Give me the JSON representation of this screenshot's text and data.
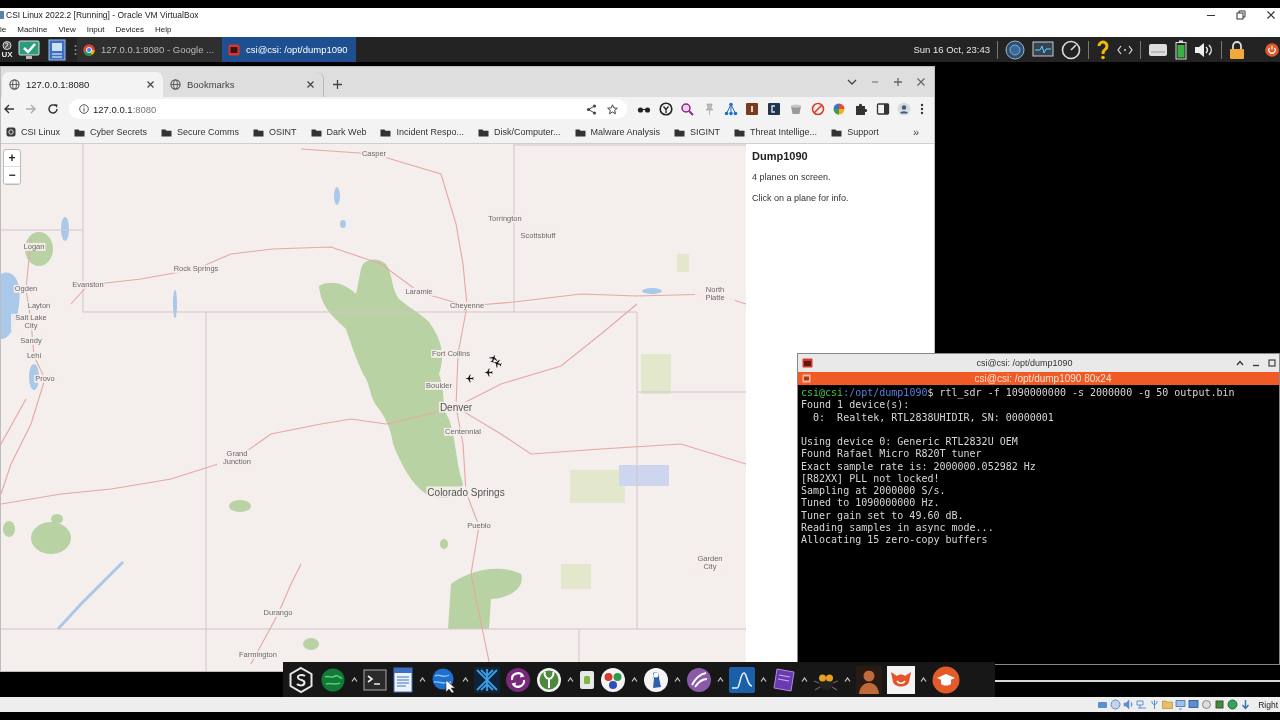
{
  "vbox_window": {
    "title": "CSI Linux 2022.2 [Running] - Oracle VM VirtualBox",
    "menu": [
      "le",
      "Machine",
      "View",
      "Input",
      "Devices",
      "Help"
    ]
  },
  "taskbar": {
    "logo_text": "UX",
    "tasks": [
      {
        "label": "127.0.0.1:8080 - Google ...",
        "kind": "browser",
        "selected": false
      },
      {
        "label": "csi@csi: /opt/dump1090",
        "kind": "terminal",
        "selected": true
      }
    ],
    "clock": "Sun 16 Oct, 23:43"
  },
  "browser": {
    "tabs": [
      {
        "label": "127.0.0.1:8080",
        "selected": true
      },
      {
        "label": "Bookmarks",
        "selected": false
      }
    ],
    "address": {
      "host": "127.0.0.1",
      "port": ":8080"
    },
    "bookmarks": [
      {
        "label": "CSI Linux",
        "kind": "site"
      },
      {
        "label": "Cyber Secrets",
        "kind": "folder"
      },
      {
        "label": "Secure Comms",
        "kind": "folder"
      },
      {
        "label": "OSINT",
        "kind": "folder"
      },
      {
        "label": "Dark Web",
        "kind": "folder"
      },
      {
        "label": "Incident Respo...",
        "kind": "folder"
      },
      {
        "label": "Disk/Computer...",
        "kind": "folder"
      },
      {
        "label": "Malware Analysis",
        "kind": "folder"
      },
      {
        "label": "SIGINT",
        "kind": "folder"
      },
      {
        "label": "Threat Intellige...",
        "kind": "folder"
      },
      {
        "label": "Support",
        "kind": "folder"
      }
    ],
    "bookmarks_overflow": "»"
  },
  "map": {
    "zoom_in": "+",
    "zoom_out": "−",
    "cities": [
      {
        "name": "Casper",
        "kind": "town"
      },
      {
        "name": "Torrington",
        "kind": "town"
      },
      {
        "name": "Scottsbluff",
        "kind": "town"
      },
      {
        "name": "Logan",
        "kind": "town"
      },
      {
        "name": "Rock Springs",
        "kind": "town"
      },
      {
        "name": "Ogden",
        "kind": "town"
      },
      {
        "name": "Evanston",
        "kind": "town"
      },
      {
        "name": "Laramie",
        "kind": "town"
      },
      {
        "name": "North Platte",
        "kind": "town"
      },
      {
        "name": "Layton",
        "kind": "town"
      },
      {
        "name": "Cheyenne",
        "kind": "town"
      },
      {
        "name": "Salt Lake City",
        "kind": "town"
      },
      {
        "name": "Sandy",
        "kind": "town"
      },
      {
        "name": "Lehi",
        "kind": "town"
      },
      {
        "name": "Fort Collins",
        "kind": "town"
      },
      {
        "name": "Provo",
        "kind": "town"
      },
      {
        "name": "Boulder",
        "kind": "town"
      },
      {
        "name": "Denver",
        "kind": "major"
      },
      {
        "name": "Centennial",
        "kind": "town"
      },
      {
        "name": "Grand Junction",
        "kind": "town"
      },
      {
        "name": "Colorado Springs",
        "kind": "major"
      },
      {
        "name": "Pueblo",
        "kind": "town"
      },
      {
        "name": "Garden City",
        "kind": "town"
      },
      {
        "name": "Durango",
        "kind": "town"
      },
      {
        "name": "Farmington",
        "kind": "town"
      }
    ]
  },
  "info_panel": {
    "title": "Dump1090",
    "plane_count": "4 planes on screen.",
    "hint": "Click on a plane for info."
  },
  "terminal": {
    "title": "csi@csi: /opt/dump1090",
    "tab_title": "csi@csi: /opt/dump1090 80x24",
    "prompt": {
      "user": "csi@csi",
      "path": ":/opt/dump1090",
      "command": "$ rtl_sdr -f 1090000000 -s 2000000 -g 50 output.bin"
    },
    "output_blocks": [
      [
        "Found 1 device(s):",
        "  0:  Realtek, RTL2838UHIDIR, SN: 00000001"
      ],
      [
        "Using device 0: Generic RTL2832U OEM",
        "Found Rafael Micro R820T tuner",
        "Exact sample rate is: 2000000.052982 Hz",
        "[R82XX] PLL not locked!",
        "Sampling at 2000000 S/s.",
        "Tuned to 1090000000 Hz.",
        "Tuner gain set to 49.60 dB.",
        "Reading samples in async mode...",
        "Allocating 15 zero-copy buffers"
      ]
    ]
  },
  "vbox_status_bar": {
    "host_key": "Right"
  }
}
